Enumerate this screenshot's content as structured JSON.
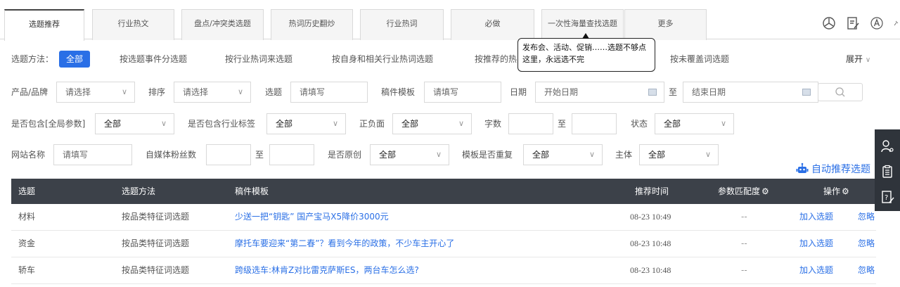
{
  "tabs": [
    {
      "label": "选题推荐",
      "active": true
    },
    {
      "label": "行业热文"
    },
    {
      "label": "盘点/冲突类选题"
    },
    {
      "label": "热词历史翻炒"
    },
    {
      "label": "行业热词"
    },
    {
      "label": "必做"
    },
    {
      "label": "一次性海量查找选题"
    },
    {
      "label": "更多"
    }
  ],
  "toolbar_icons": [
    "compass-icon",
    "edit-doc-icon",
    "font-a-icon",
    "pin-icon"
  ],
  "tooltip": {
    "text": "发布会、活动、促销……选题不够点这里，永远选不完"
  },
  "methods": {
    "label": "选题方法：",
    "all": "全部",
    "items": [
      "按选题事件分选题",
      "按行业热词来选题",
      "按自身和相关行业热词选题",
      "按推荐的热",
      "按未覆盖词选题"
    ],
    "expand": "展开"
  },
  "row2": {
    "brand_label": "产品/品牌",
    "brand_value": "请选择",
    "sort_label": "排序",
    "sort_value": "请选择",
    "topic_label": "选题",
    "topic_value": "请填写",
    "template_label": "稿件模板",
    "template_value": "请填写",
    "date_label": "日期",
    "date_start": "开始日期",
    "to": "至",
    "date_end": "结束日期"
  },
  "row3": {
    "global_label": "是否包含[全局参数]",
    "global_value": "全部",
    "industry_label": "是否包含行业标签",
    "industry_value": "全部",
    "polarity_label": "正负面",
    "polarity_value": "全部",
    "words_label": "字数",
    "to": "至",
    "status_label": "状态",
    "status_value": "全部"
  },
  "row4": {
    "site_label": "网站名称",
    "site_value": "请填写",
    "fans_label": "自媒体粉丝数",
    "to": "至",
    "original_label": "是否原创",
    "original_value": "全部",
    "dup_label": "模板是否重复",
    "dup_value": "全部",
    "subject_label": "主体",
    "subject_value": "全部"
  },
  "auto_recommend": "自动推荐选题",
  "table": {
    "headers": [
      "选题",
      "选题方法",
      "稿件模板",
      "推荐时间",
      "参数匹配度",
      "操作"
    ],
    "rows": [
      {
        "topic": "材料",
        "method": "按品类特征词选题",
        "title": "少送一把“钥匙” 国产宝马X5降价3000元",
        "time": "08-23 10:49",
        "match": "--",
        "add": "加入选题",
        "ignore": "忽略"
      },
      {
        "topic": "资金",
        "method": "按品类特征词选题",
        "title": "摩托车要迎来“第二春”？看到今年的政策，不少车主开心了",
        "time": "08-23 10:48",
        "match": "--",
        "add": "加入选题",
        "ignore": "忽略"
      },
      {
        "topic": "轿车",
        "method": "按品类特征词选题",
        "title": "跨级选车:林肯Z对比雷克萨斯ES，两台车怎么选?",
        "time": "08-23 10:48",
        "match": "--",
        "add": "加入选题",
        "ignore": "忽略"
      }
    ]
  },
  "colors": {
    "accent": "#2a6fe6",
    "header_bg": "#3c4149",
    "sidebar_bg": "#2f343b"
  }
}
